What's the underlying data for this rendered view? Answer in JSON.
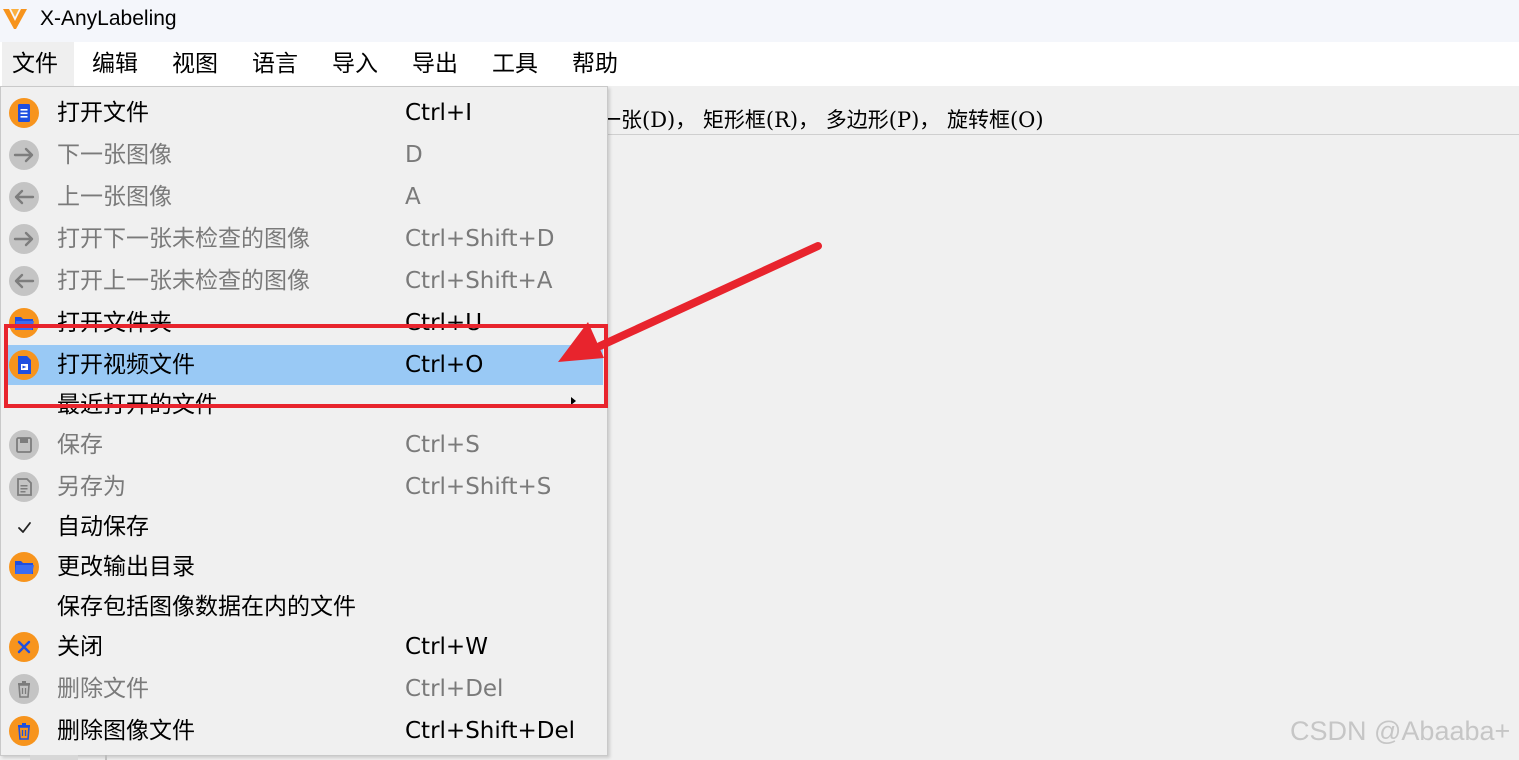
{
  "window": {
    "title": "X-AnyLabeling"
  },
  "menubar": {
    "items": [
      {
        "label": "文件",
        "active": true
      },
      {
        "label": "编辑"
      },
      {
        "label": "视图"
      },
      {
        "label": "语言"
      },
      {
        "label": "导入"
      },
      {
        "label": "导出"
      },
      {
        "label": "工具"
      },
      {
        "label": "帮助"
      }
    ]
  },
  "toolbar": {
    "hint": "一张(D)， 矩形框(R)， 多边形(P)， 旋转框(O)"
  },
  "file_menu": {
    "items": [
      {
        "label": "打开文件",
        "shortcut": "Ctrl+I",
        "icon": "document-icon",
        "enabled": true
      },
      {
        "label": "下一张图像",
        "shortcut": "D",
        "icon": "arrow-right-icon",
        "enabled": false
      },
      {
        "label": "上一张图像",
        "shortcut": "A",
        "icon": "arrow-left-icon",
        "enabled": false
      },
      {
        "label": "打开下一张未检查的图像",
        "shortcut": "Ctrl+Shift+D",
        "icon": "arrow-right-icon",
        "enabled": false
      },
      {
        "label": "打开上一张未检查的图像",
        "shortcut": "Ctrl+Shift+A",
        "icon": "arrow-left-icon",
        "enabled": false
      },
      {
        "label": "打开文件夹",
        "shortcut": "Ctrl+U",
        "icon": "folder-icon",
        "enabled": true
      },
      {
        "label": "打开视频文件",
        "shortcut": "Ctrl+O",
        "icon": "video-file-icon",
        "enabled": true,
        "highlighted": true
      },
      {
        "label": "最近打开的文件",
        "shortcut": "",
        "icon": "",
        "enabled": true,
        "submenu": true
      },
      {
        "label": "保存",
        "shortcut": "Ctrl+S",
        "icon": "save-icon",
        "enabled": false
      },
      {
        "label": "另存为",
        "shortcut": "Ctrl+Shift+S",
        "icon": "save-as-icon",
        "enabled": false
      },
      {
        "label": "自动保存",
        "shortcut": "",
        "icon": "checkmark-icon",
        "enabled": true,
        "checked": true
      },
      {
        "label": "更改输出目录",
        "shortcut": "",
        "icon": "folder-icon",
        "enabled": true
      },
      {
        "label": "保存包括图像数据在内的文件",
        "shortcut": "",
        "icon": "",
        "enabled": true
      },
      {
        "label": "关闭",
        "shortcut": "Ctrl+W",
        "icon": "close-icon",
        "enabled": true
      },
      {
        "label": "删除文件",
        "shortcut": "Ctrl+Del",
        "icon": "trash-icon",
        "enabled": false
      },
      {
        "label": "删除图像文件",
        "shortcut": "Ctrl+Shift+Del",
        "icon": "trash-icon",
        "enabled": true
      }
    ]
  },
  "watermark": "CSDN @Abaaba+",
  "colors": {
    "accent_orange": "#f7941d",
    "icon_blue": "#1f4fe0",
    "highlight": "#99c9f5",
    "annotation_red": "#e8242d",
    "disabled_icon": "#c4c4c4"
  }
}
